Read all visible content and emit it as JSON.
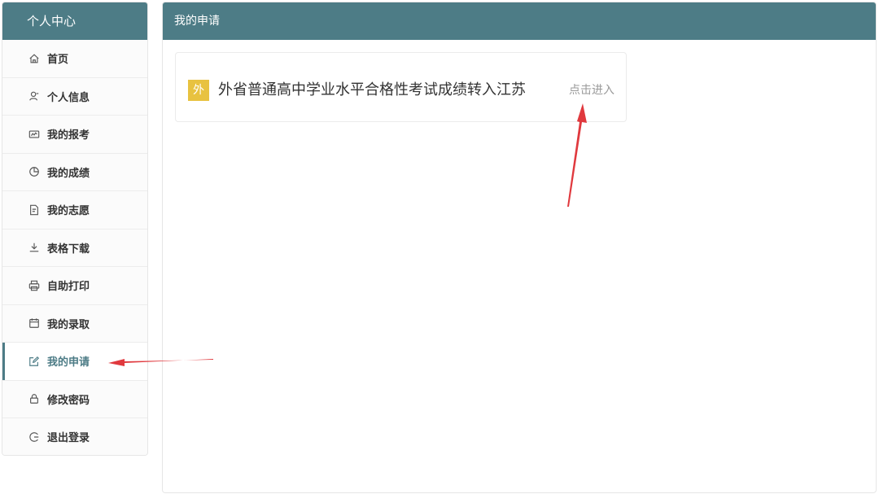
{
  "sidebar": {
    "title": "个人中心",
    "items": [
      {
        "label": "首页",
        "icon": "home-icon"
      },
      {
        "label": "个人信息",
        "icon": "user-icon"
      },
      {
        "label": "我的报考",
        "icon": "ticket-icon"
      },
      {
        "label": "我的成绩",
        "icon": "pie-chart-icon"
      },
      {
        "label": "我的志愿",
        "icon": "document-icon"
      },
      {
        "label": "表格下载",
        "icon": "download-icon"
      },
      {
        "label": "自助打印",
        "icon": "printer-icon"
      },
      {
        "label": "我的录取",
        "icon": "calendar-icon"
      },
      {
        "label": "我的申请",
        "icon": "edit-icon",
        "active": true
      },
      {
        "label": "修改密码",
        "icon": "lock-icon"
      },
      {
        "label": "退出登录",
        "icon": "logout-icon"
      }
    ]
  },
  "main": {
    "title": "我的申请",
    "applications": [
      {
        "badge": "外",
        "title": "外省普通高中学业水平合格性考试成绩转入江苏",
        "action": "点击进入"
      }
    ]
  },
  "colors": {
    "header": "#4d7c86",
    "badge": "#e8c240",
    "annotation_arrow": "#e0393e"
  }
}
